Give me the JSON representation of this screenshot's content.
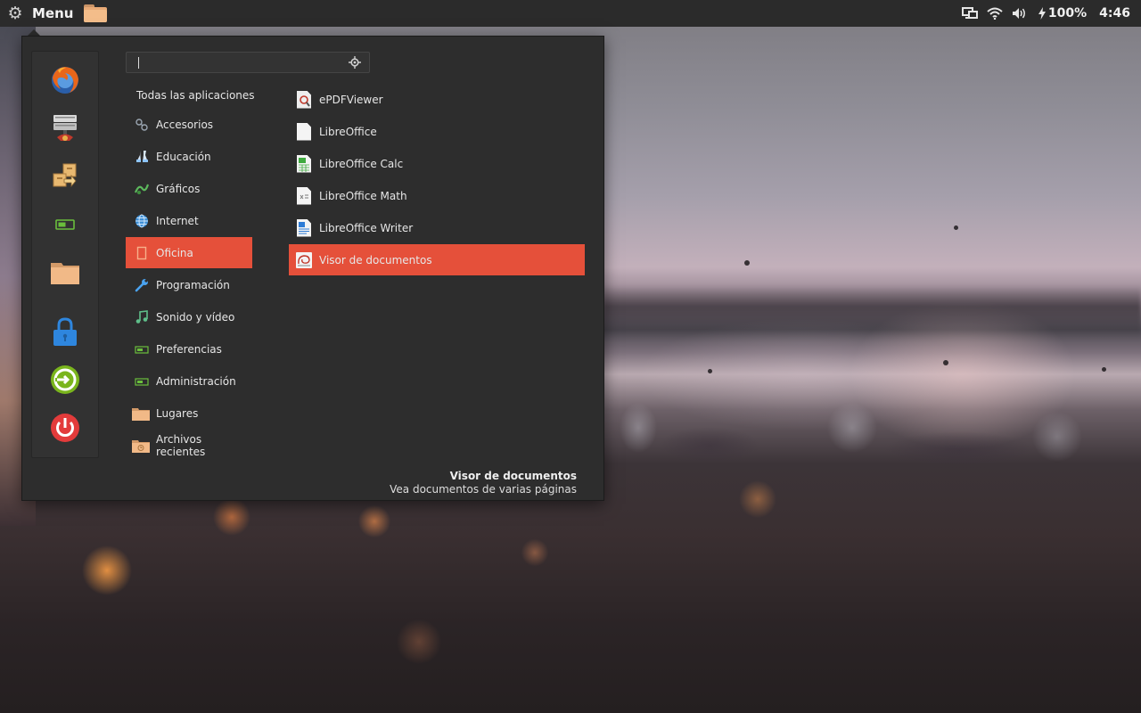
{
  "panel": {
    "menu_label": "Menu",
    "battery_text": "100%",
    "clock_text": "4:46",
    "icons": [
      "gear-icon",
      "folder-icon",
      "display-icon",
      "wifi-icon",
      "volume-icon",
      "power-bolt-icon"
    ]
  },
  "favorites": [
    {
      "name": "firefox-icon"
    },
    {
      "name": "network-server-icon"
    },
    {
      "name": "package-icon"
    },
    {
      "name": "preferences-icon"
    },
    {
      "name": "home-folder-icon"
    },
    {
      "name": "lock-screen-icon"
    },
    {
      "name": "logout-icon"
    },
    {
      "name": "shutdown-icon"
    }
  ],
  "search": {
    "value": ""
  },
  "categories_header": "Todas las aplicaciones",
  "categories": [
    {
      "label": "Accesorios",
      "icon": "accessories-icon"
    },
    {
      "label": "Educación",
      "icon": "education-icon"
    },
    {
      "label": "Gráficos",
      "icon": "graphics-icon"
    },
    {
      "label": "Internet",
      "icon": "globe-icon"
    },
    {
      "label": "Oficina",
      "icon": "office-icon",
      "active": true
    },
    {
      "label": "Programación",
      "icon": "wrench-icon"
    },
    {
      "label": "Sonido y vídeo",
      "icon": "music-note-icon"
    },
    {
      "label": "Preferencias",
      "icon": "preferences-icon"
    },
    {
      "label": "Administración",
      "icon": "administration-icon"
    },
    {
      "label": "Lugares",
      "icon": "folder-icon"
    },
    {
      "label": "Archivos recientes",
      "icon": "recent-folder-icon"
    }
  ],
  "apps": [
    {
      "label": "ePDFViewer",
      "icon": "pdf-viewer-icon"
    },
    {
      "label": "LibreOffice",
      "icon": "libreoffice-icon"
    },
    {
      "label": "LibreOffice Calc",
      "icon": "calc-icon"
    },
    {
      "label": "LibreOffice Math",
      "icon": "math-icon"
    },
    {
      "label": "LibreOffice Writer",
      "icon": "writer-icon"
    },
    {
      "label": "Visor de documentos",
      "icon": "document-viewer-icon",
      "active": true
    }
  ],
  "description": {
    "title": "Visor de documentos",
    "text": "Vea documentos de varias páginas"
  },
  "colors": {
    "accent": "#e5503a",
    "panel_bg": "#2b2b2b",
    "menu_bg": "#2d2d2d"
  }
}
